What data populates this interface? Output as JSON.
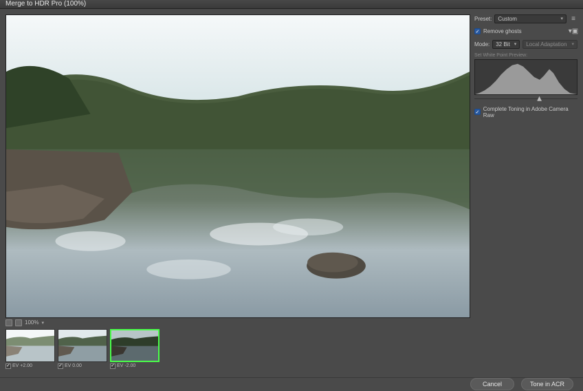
{
  "title": "Merge to HDR Pro (100%)",
  "preview_toolbar": {
    "zoom": "100%"
  },
  "thumbnails": [
    {
      "label": "EV +2.00",
      "checked": true,
      "active": false
    },
    {
      "label": "EV 0.00",
      "checked": true,
      "active": false
    },
    {
      "label": "EV -2.00",
      "checked": true,
      "active": true
    }
  ],
  "sidebar": {
    "preset_label": "Preset:",
    "preset_value": "Custom",
    "remove_ghosts_label": "Remove ghosts",
    "remove_ghosts_checked": true,
    "mode_label": "Mode:",
    "mode_value": "32 Bit",
    "adaptation_value": "Local Adaptation",
    "wp_label": "Set White Point Preview:",
    "complete_toning_label": "Complete Toning in Adobe Camera Raw",
    "complete_toning_checked": true
  },
  "footer": {
    "cancel": "Cancel",
    "ok": "Tone in ACR"
  }
}
